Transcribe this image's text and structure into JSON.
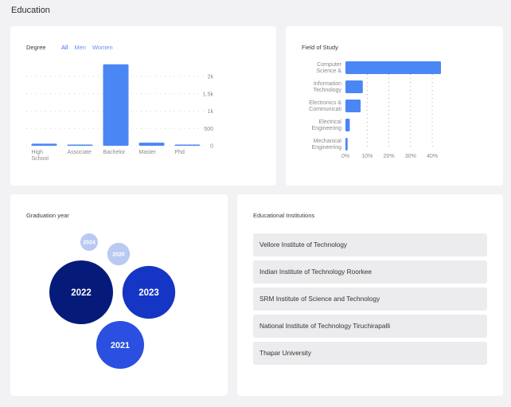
{
  "page": {
    "title": "Education"
  },
  "degree_card": {
    "title": "Degree",
    "filters": [
      {
        "label": "All"
      },
      {
        "label": "Men"
      },
      {
        "label": "Women"
      }
    ]
  },
  "field_card": {
    "title": "Field of Study"
  },
  "grad_card": {
    "title": "Graduation year"
  },
  "institutions_card": {
    "title": "Educational Institutions",
    "items": [
      "Vellore Institute of Technology",
      "Indian Institute of Technology Roorkee",
      "SRM Institute of Science and Technology",
      "National Institute of Technology Tiruchirapalli",
      "Thapar University"
    ]
  },
  "colors": {
    "accent": "#4b86f5",
    "filter_active": "#3b6cf5",
    "filter_inactive": "#6b8ef7"
  },
  "chart_data": [
    {
      "id": "degree",
      "type": "bar",
      "title": "Degree",
      "categories": [
        "High School",
        "Associate",
        "Bachelor",
        "Master",
        "Phd"
      ],
      "category_lines": [
        [
          "High",
          "School"
        ],
        [
          "Associate"
        ],
        [
          "Bachelor"
        ],
        [
          "Master"
        ],
        [
          "Phd"
        ]
      ],
      "values": [
        60,
        20,
        2350,
        90,
        5
      ],
      "ylim": [
        0,
        2000
      ],
      "yticks": [
        0,
        500,
        1000,
        1500,
        2000
      ],
      "ytick_labels": [
        "0",
        "500",
        "1k",
        "1.5k",
        "2k"
      ],
      "axis_side": "right",
      "grid": true
    },
    {
      "id": "field",
      "type": "bar",
      "orientation": "horizontal",
      "title": "Field of Study",
      "categories": [
        "Computer Science &",
        "Information Technology",
        "Electronics & Communication",
        "Electrical Engineering",
        "Mechanical Engineering"
      ],
      "category_lines": [
        [
          "Computer",
          "Science &"
        ],
        [
          "Information",
          "Technology"
        ],
        [
          "Electronics &",
          "Communicati"
        ],
        [
          "Electrical",
          "Engineering"
        ],
        [
          "Mechanical",
          "Engineering"
        ]
      ],
      "values": [
        44,
        8,
        7,
        2,
        1
      ],
      "xlim": [
        0,
        44
      ],
      "xticks": [
        0,
        10,
        20,
        30,
        40
      ],
      "xtick_labels": [
        "0%",
        "10%",
        "20%",
        "30%",
        "40%"
      ],
      "grid": true
    },
    {
      "id": "graduation",
      "type": "bubble",
      "title": "Graduation year",
      "items": [
        {
          "label": "2024",
          "value": 6,
          "color": "#b8c9f2"
        },
        {
          "label": "2020",
          "value": 10,
          "color": "#b8c9f2"
        },
        {
          "label": "2022",
          "value": 80,
          "color": "#061a7a"
        },
        {
          "label": "2023",
          "value": 55,
          "color": "#1536c4"
        },
        {
          "label": "2021",
          "value": 45,
          "color": "#2b4fe0"
        }
      ]
    }
  ]
}
